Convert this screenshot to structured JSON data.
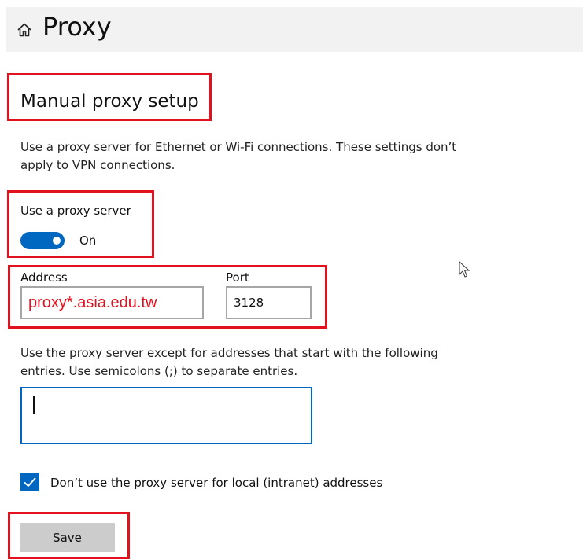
{
  "header": {
    "title": "Proxy",
    "home_icon": "home-icon"
  },
  "manual_proxy": {
    "section_title": "Manual proxy setup",
    "description": "Use a proxy server for Ethernet or Wi-Fi connections. These settings don’t apply to VPN connections.",
    "use_proxy_label": "Use a proxy server",
    "toggle_state": "On",
    "address_label": "Address",
    "address_value": "proxy*.asia.edu.tw",
    "port_label": "Port",
    "port_value": "3128",
    "exceptions_description": "Use the proxy server except for addresses that start with the following entries. Use semicolons (;) to separate entries.",
    "exceptions_value": "",
    "local_bypass_label": "Don’t use the proxy server for local (intranet) addresses",
    "local_bypass_checked": true,
    "save_label": "Save"
  },
  "colors": {
    "accent": "#0067c0",
    "highlight": "#e3101e",
    "header_bg": "#f2f2f2",
    "button_bg": "#cccccc"
  }
}
